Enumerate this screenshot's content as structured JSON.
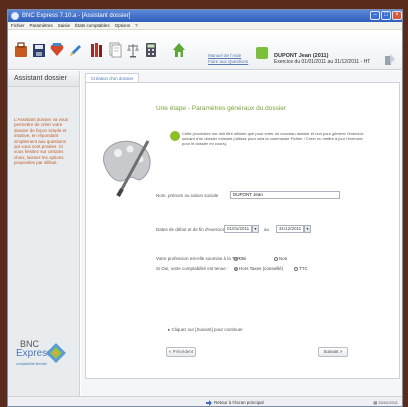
{
  "window": {
    "title": "BNC Express 7.10.a - [Assistant dossier]"
  },
  "menubar": {
    "items": [
      "Fichier",
      "Paramètres",
      "Saisie",
      "États comptables",
      "Options",
      "?"
    ]
  },
  "toolbar": {
    "links": [
      "Manuel de l'Aide",
      "Foire aux Questions"
    ],
    "user_name": "DUPONT Jean (2011)",
    "exercise": "Exercice du 01/01/2011 au 31/12/2011 - HT"
  },
  "sidebar": {
    "title": "Assistant dossier",
    "help_text": "L'Assistant dossier va vous permettre de créer votre dossier de façon simple et intuitive, en répondant simplement aux questions qui vous sont posées. Si vous hésitez sur certains choix, laissez les options proposées par défaut.",
    "logo_bnc": "BNC",
    "logo_express": "Express",
    "logo_sub": "comptabilité libérale"
  },
  "main": {
    "tab": "Création d'un dossier",
    "step_title": "Une étape - Paramètres généraux du dossier",
    "info_text": "Cette procédure me doit être utilisée que pour créer un nouveau dossier et non pour générer l'exercice suivant d'un dossier existant (utilisez pour cela la commande Fichier / Créer ou mettre à jour l'exercice pour le dossier en cours).",
    "name_label": "Nom, prénom ou raison sociale",
    "name_value": "DUPONT Jean",
    "dates_label": "Dates de début et de fin d'exercice",
    "date_start": "01/01/2011",
    "date_sep": "au",
    "date_end": "31/12/2011",
    "tva_label": "Votre profession est-elle soumise à la TVA ?",
    "tva_yes": "Oui",
    "tva_no": "Non",
    "compta_label": "Si Oui, votre comptabilité est tenue :",
    "compta_ht": "Hors Taxes (conseillé)",
    "compta_ttc": "TTC",
    "continue_text": "Cliquez sur [Suivant] pour continuer",
    "prev_button": "< Précédent",
    "next_button": "Suivant >"
  },
  "footer": {
    "back_link": "Retour à l'écran principal",
    "date": "26/02/2011"
  },
  "colors": {
    "title_bar": "#2f5ebd",
    "accent_green": "#7ba23a",
    "help_text": "#c05b2a",
    "link_blue": "#5b7bb5"
  }
}
